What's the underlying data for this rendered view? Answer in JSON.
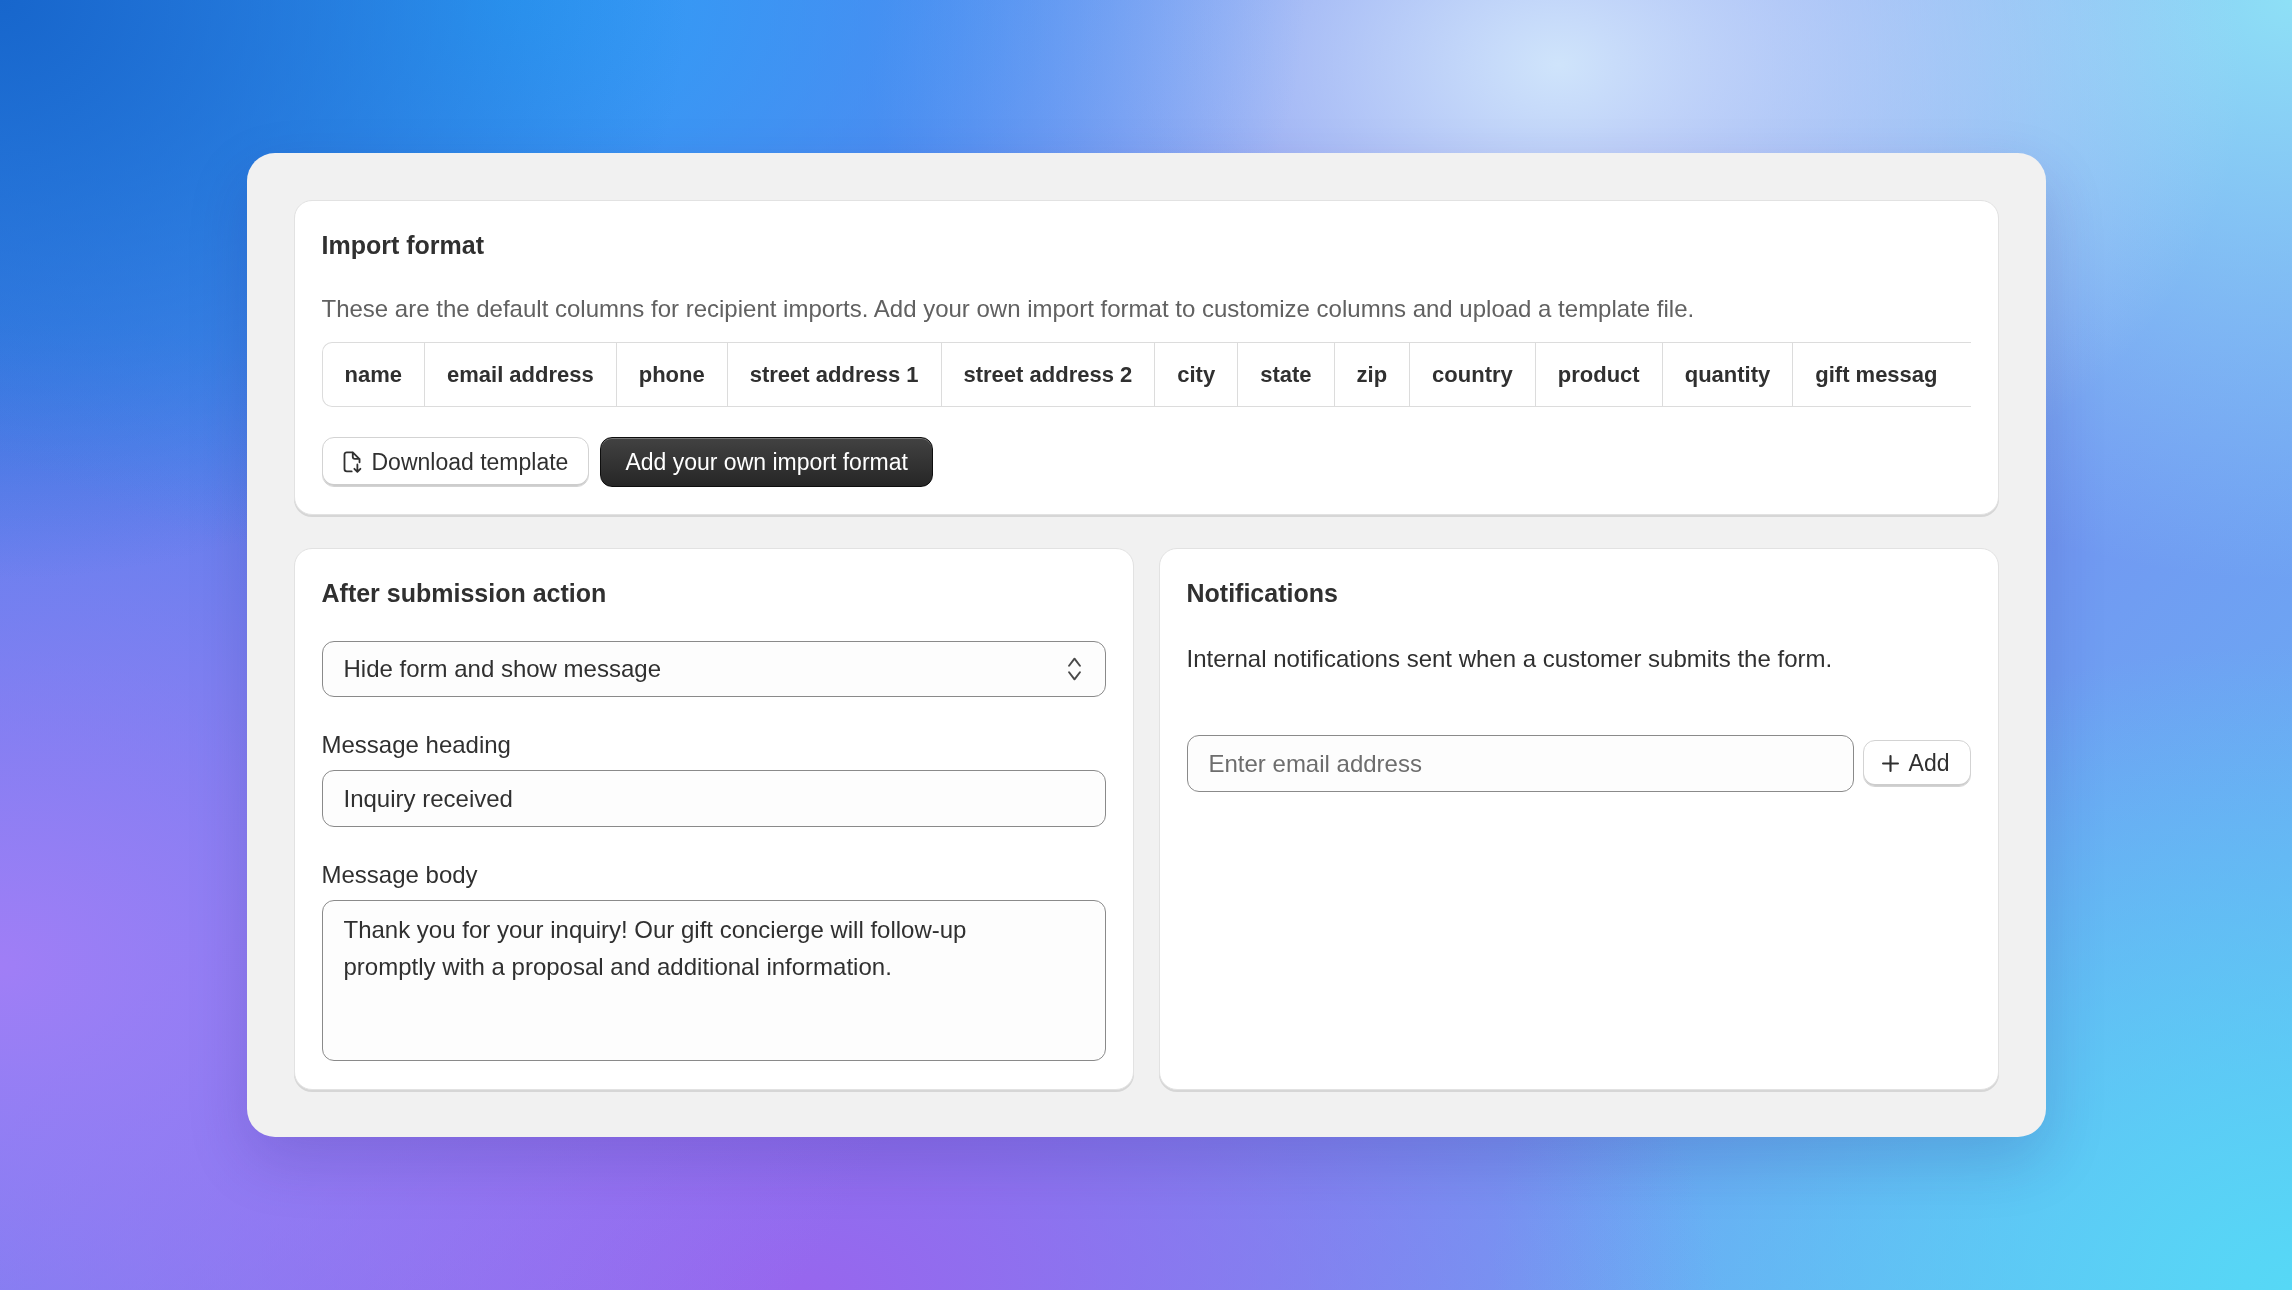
{
  "import_format": {
    "title": "Import format",
    "description": "These are the default columns for recipient imports. Add your own import format to customize columns and upload a template file.",
    "columns": [
      "name",
      "email address",
      "phone",
      "street address 1",
      "street address 2",
      "city",
      "state",
      "zip",
      "country",
      "product",
      "quantity",
      "gift messag"
    ],
    "buttons": [
      {
        "label": "Download template",
        "kind": "secondary"
      },
      {
        "label": "Add your own import format",
        "kind": "primary"
      }
    ]
  },
  "after_submission": {
    "title": "After submission action",
    "action_select": {
      "value": "Hide form and show message"
    },
    "fields": [
      {
        "label": "Message heading",
        "kind": "text",
        "value": "Inquiry received"
      },
      {
        "label": "Message body",
        "kind": "multiline",
        "value": "Thank you for your inquiry! Our gift concierge will follow-up promptly with a proposal and additional information."
      }
    ]
  },
  "notifications": {
    "title": "Notifications",
    "description": "Internal notifications sent when a customer submits the form.",
    "email_field": {
      "placeholder": "Enter email address"
    },
    "add_button": {
      "label": "Add"
    }
  }
}
